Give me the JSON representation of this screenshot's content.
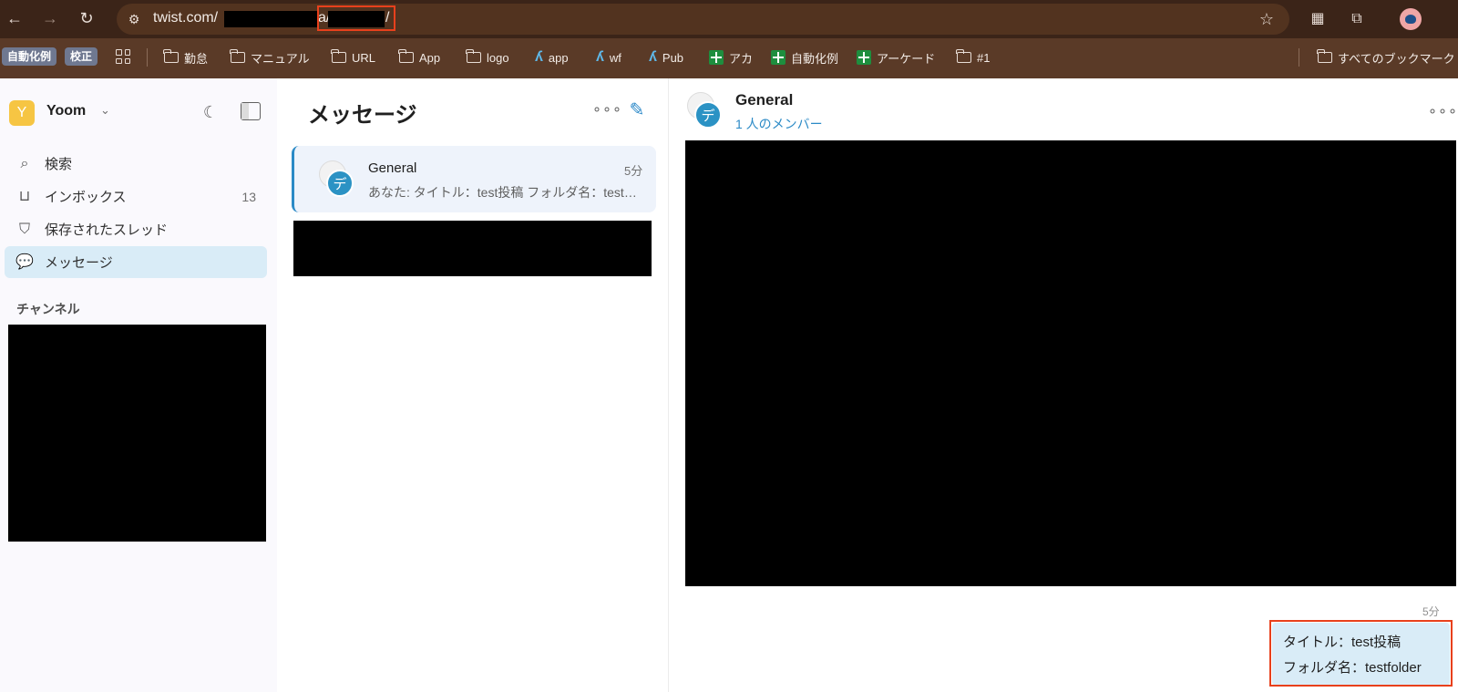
{
  "browser": {
    "url_prefix": "twist.com/",
    "url_mid_char": "a/",
    "url_end_char": "/",
    "bookmarks": [
      {
        "label": "自動化例",
        "kind": "badge"
      },
      {
        "label": "校正",
        "kind": "badge"
      },
      {
        "label": "勤怠",
        "kind": "folder"
      },
      {
        "label": "マニュアル",
        "kind": "folder"
      },
      {
        "label": "URL",
        "kind": "folder"
      },
      {
        "label": "App",
        "kind": "folder"
      },
      {
        "label": "logo",
        "kind": "folder"
      },
      {
        "label": "app",
        "kind": "twist"
      },
      {
        "label": "wf",
        "kind": "twist"
      },
      {
        "label": "Pub",
        "kind": "twist"
      },
      {
        "label": "アカ",
        "kind": "sheet"
      },
      {
        "label": "自動化例",
        "kind": "sheet"
      },
      {
        "label": "アーケード",
        "kind": "sheet"
      },
      {
        "label": "#1",
        "kind": "folder"
      }
    ],
    "all_bookmarks_label": "すべてのブックマーク"
  },
  "sidebar": {
    "workspace_initial": "Y",
    "workspace_name": "Yoom",
    "nav": [
      {
        "label": "検索",
        "icon": "search-icon"
      },
      {
        "label": "インボックス",
        "icon": "inbox-icon",
        "count": "13"
      },
      {
        "label": "保存されたスレッド",
        "icon": "bookmark-icon"
      },
      {
        "label": "メッセージ",
        "icon": "message-icon",
        "active": true
      }
    ],
    "channels_header": "チャンネル"
  },
  "threads": {
    "title": "メッセージ",
    "items": [
      {
        "avatar_initial": "デ",
        "name": "General",
        "time": "5分",
        "snippet": "あなた: タイトル：test投稿 フォルダ名：testfolder"
      }
    ]
  },
  "conversation": {
    "avatar_initial": "デ",
    "title": "General",
    "members": "1 人のメンバー",
    "message": {
      "time": "5分",
      "lines": [
        "タイトル：test投稿",
        "フォルダ名：testfolder"
      ]
    }
  },
  "colors": {
    "accent": "#2b8ac6",
    "highlight_box": "#e8401c",
    "active_nav_bg": "#d9ecf7"
  }
}
